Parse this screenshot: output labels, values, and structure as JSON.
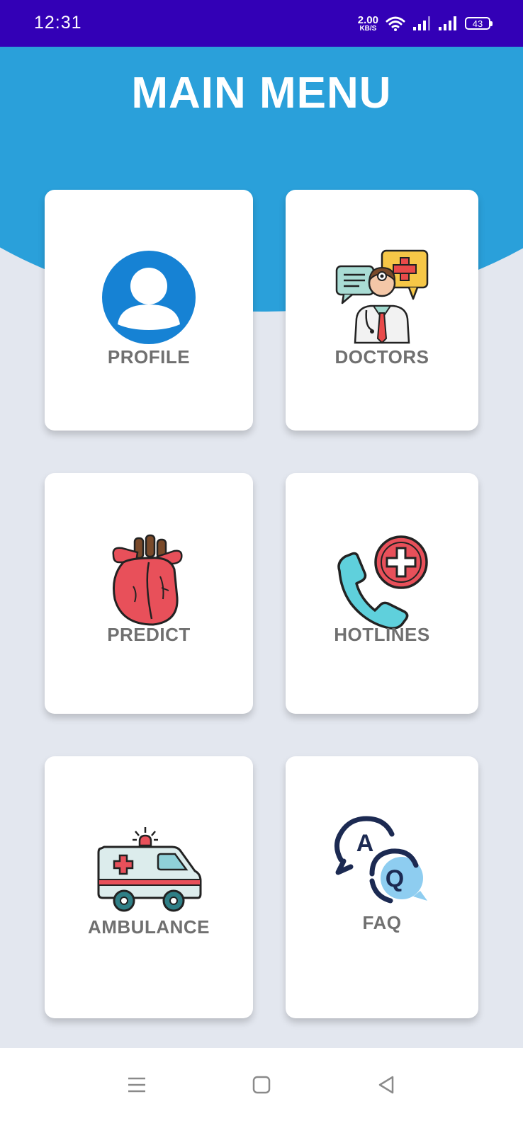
{
  "status_bar": {
    "time": "12:31",
    "net_speed_value": "2.00",
    "net_speed_unit": "KB/S",
    "battery": "43",
    "icons": [
      "wifi-icon",
      "signal-icon",
      "signal-icon",
      "battery-icon"
    ]
  },
  "header": {
    "title": "MAIN MENU"
  },
  "menu": {
    "items": [
      {
        "label": "PROFILE",
        "icon": "profile-icon"
      },
      {
        "label": "DOCTORS",
        "icon": "doctor-chat-icon"
      },
      {
        "label": "PREDICT",
        "icon": "heart-icon"
      },
      {
        "label": "HOTLINES",
        "icon": "phone-medical-icon"
      },
      {
        "label": "AMBULANCE",
        "icon": "ambulance-icon"
      },
      {
        "label": "FAQ",
        "icon": "faq-icon"
      }
    ]
  },
  "nav_bar": {
    "buttons": [
      "menu-icon",
      "home-icon",
      "back-icon"
    ]
  },
  "colors": {
    "status_bar": "#3300b6",
    "header": "#2aa0da",
    "background": "#e3e7ef",
    "card": "#ffffff",
    "label": "#707070"
  }
}
